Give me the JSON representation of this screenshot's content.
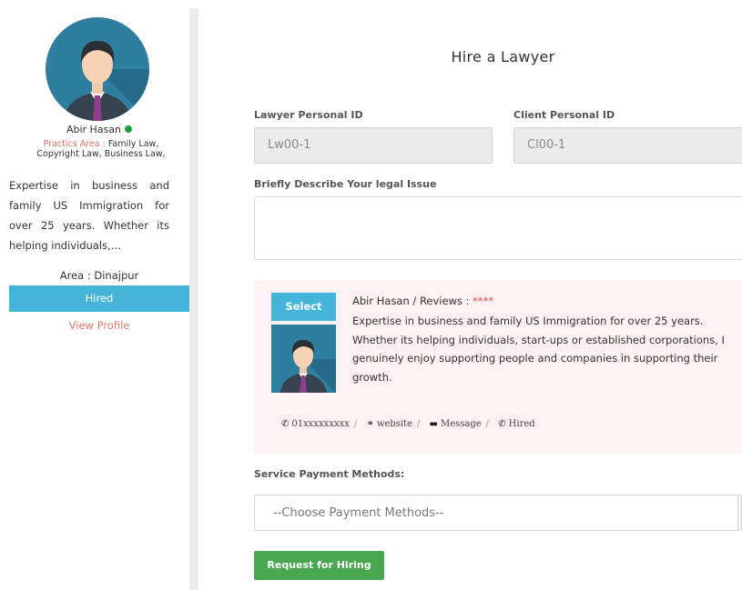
{
  "sidebar": {
    "name": "Abir Hasan",
    "practice_label": "Practics Area :",
    "practice_value": "Family Law, Copyright Law, Business Law,",
    "bio": "Expertise in business and family US Immigration for over 25 years. Whether its helping individuals,...",
    "area": "Area : Dinajpur",
    "hired": "Hired",
    "view_profile": "View Profile"
  },
  "main": {
    "title": "Hire a Lawyer",
    "lawyer_id_label": "Lawyer Personal ID",
    "lawyer_id_value": "Lw00-1",
    "client_id_label": "Client Personal ID",
    "client_id_value": "Cl00-1",
    "issue_label": "Briefly Describe Your legal Issue",
    "card": {
      "select": "Select",
      "name_reviews": "Abir Hasan / Reviews :",
      "stars": "****",
      "description": "Expertise in business and family US Immigration for over 25 years. Whether its helping individuals, start-ups or established corporations, I genuinely enjoy supporting people and companies in supporting their growth.",
      "phone": "01xxxxxxxxx",
      "website": "website",
      "message": "Message",
      "hired": "Hired",
      "sep": "/"
    },
    "payment_label": "Service Payment Methods:",
    "payment_placeholder": "--Choose Payment Methods--",
    "hire_button": "Request for Hiring"
  },
  "colors": {
    "accent_blue": "#46b3d9",
    "hire_green": "#49a74f",
    "online_green": "#1f9d36",
    "card_bg": "#fdf1f2",
    "practice_red": "#e06a6a"
  },
  "icons": [
    "phone-icon",
    "link-icon",
    "message-icon",
    "hired-icon",
    "online-status-icon",
    "avatar"
  ]
}
